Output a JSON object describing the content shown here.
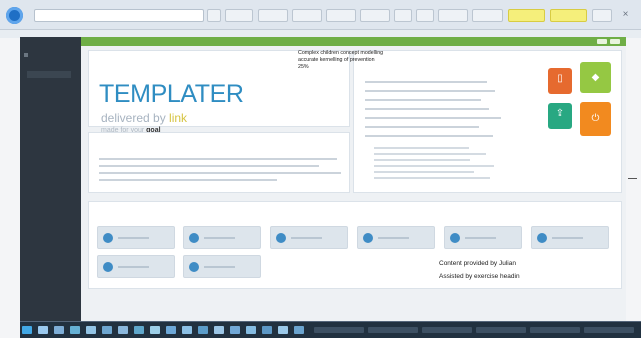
{
  "browser": {
    "url_text": "",
    "toolbar_buttons": [
      "",
      "",
      "",
      "",
      "",
      "",
      "",
      ""
    ],
    "highlight_buttons": [
      "",
      ""
    ],
    "close_label": "×"
  },
  "app_menu": {
    "items": [
      "",
      "",
      "",
      ""
    ]
  },
  "sidebar": {
    "title": "",
    "items": [
      "",
      "",
      "",
      "",
      ""
    ]
  },
  "templater": {
    "panel_label": "",
    "title": "TEMPLATER",
    "subtitle_prefix": "delivered by ",
    "subtitle_brand": "link",
    "tagline_prefix": "made for your",
    "tagline_bold": "goal"
  },
  "overlay_note": "Complex children concept modelling\naccurate kernelling of prevention\n25%",
  "panels": {
    "right_top_label": "",
    "description_label": "",
    "widgets_label": ""
  },
  "widgets": [
    "",
    "",
    "",
    "",
    "",
    "",
    "",
    ""
  ],
  "icons": [
    {
      "name": "document-icon",
      "color": "#e66a2f"
    },
    {
      "name": "tag-icon",
      "color": "#95c843"
    },
    {
      "name": "upload-icon",
      "color": "#28a882"
    },
    {
      "name": "power-icon",
      "color": "#f28a1f"
    }
  ],
  "credit_line_1": "Content provided by Julian",
  "credit_line_2": "Assisted by exercise headin",
  "taskbar": {
    "items": [
      "",
      "",
      "",
      "",
      "",
      "",
      "",
      "",
      "",
      "",
      "",
      "",
      "",
      "",
      "",
      "",
      "",
      "",
      "",
      "",
      ""
    ]
  }
}
